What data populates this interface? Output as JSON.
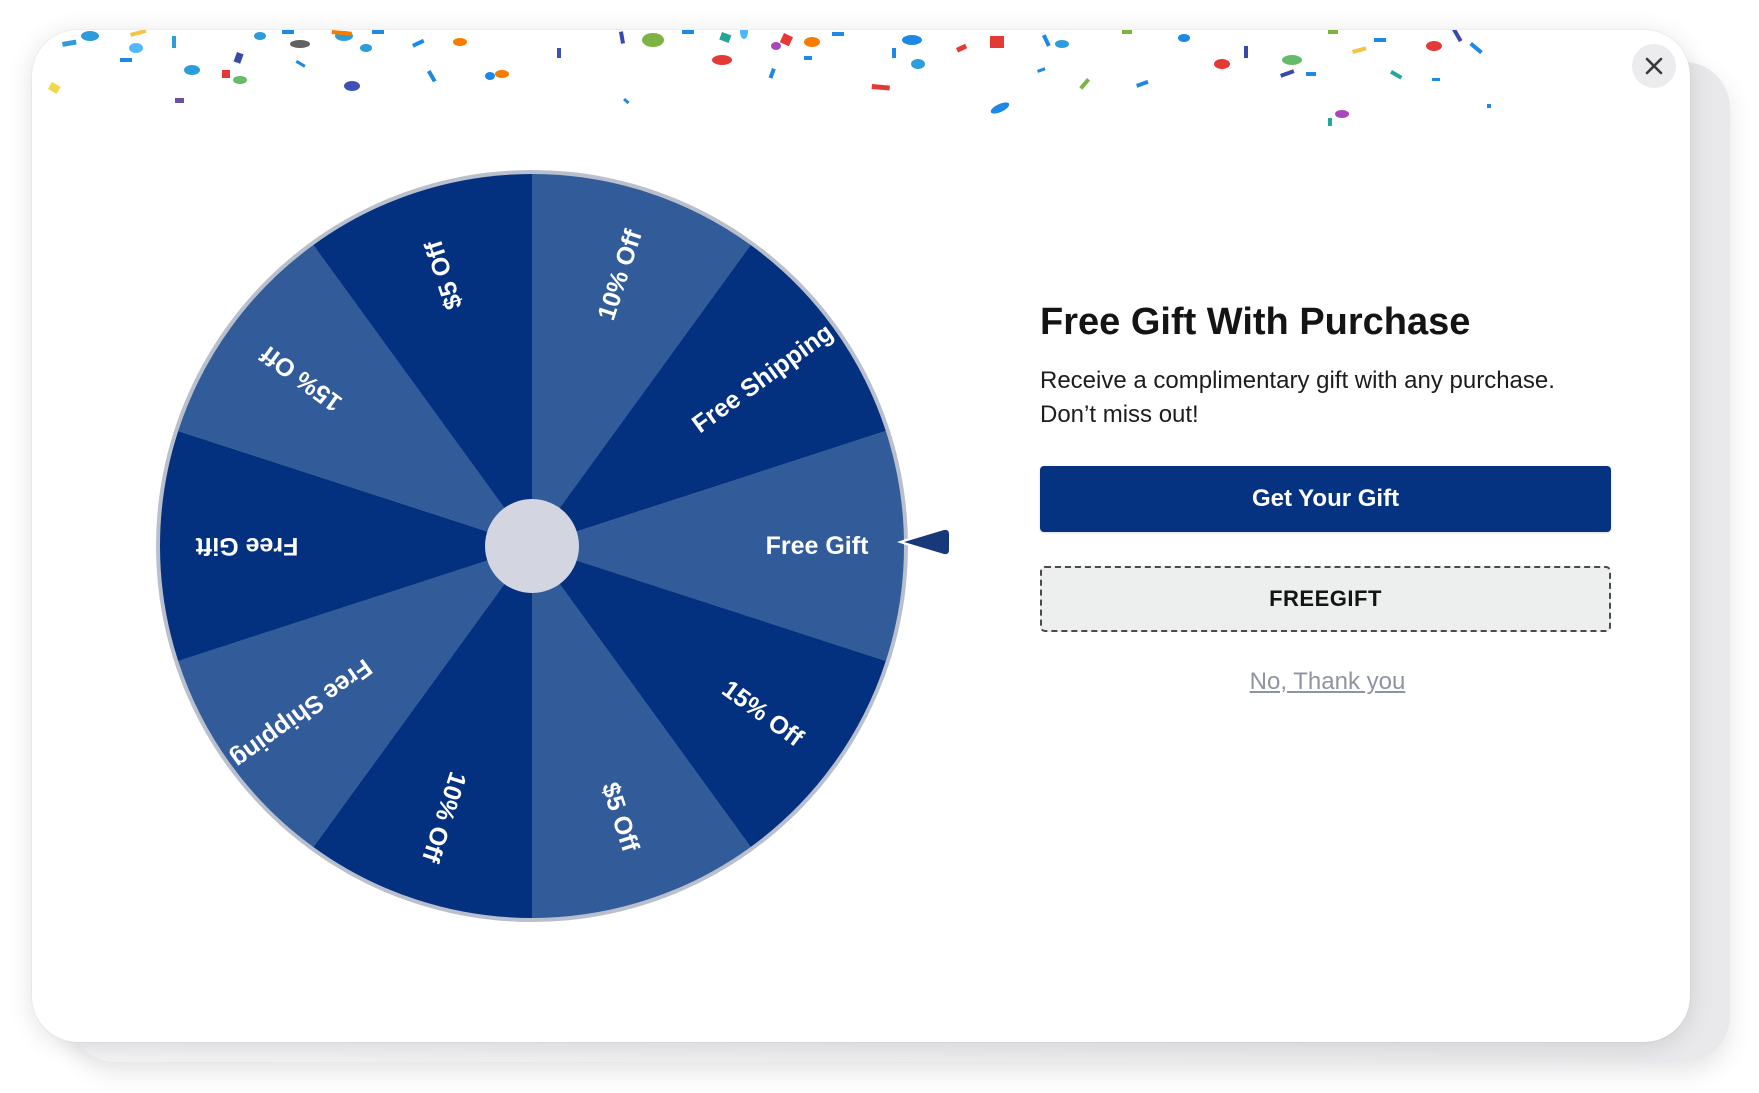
{
  "popup": {
    "title": "Free Gift With Purchase",
    "description_line1": "Receive a complimentary gift with any purchase.",
    "description_line2": "Don’t miss out!",
    "primary_button_label": "Get Your Gift",
    "coupon_code": "FREEGIFT",
    "dismiss_label": "No, Thank you",
    "close_icon": "close-icon"
  },
  "wheel": {
    "selected_prize": "Free Gift",
    "colors": {
      "dark_segment": "#04317f",
      "light_segment": "#315b99",
      "rim": "#b9bfcd",
      "hub": "#d3d6e0",
      "pointer": "#17397a"
    },
    "segments": [
      {
        "label": "10% Off",
        "shade": "light"
      },
      {
        "label": "Free Shipping",
        "shade": "dark"
      },
      {
        "label": "Free Gift",
        "shade": "light"
      },
      {
        "label": "15% Off",
        "shade": "dark"
      },
      {
        "label": "$5 Off",
        "shade": "light"
      },
      {
        "label": "10% Off",
        "shade": "dark"
      },
      {
        "label": "Free Shipping",
        "shade": "light"
      },
      {
        "label": "Free Gift",
        "shade": "dark"
      },
      {
        "label": "15% Off",
        "shade": "light"
      },
      {
        "label": "$5 Off",
        "shade": "dark"
      }
    ]
  }
}
